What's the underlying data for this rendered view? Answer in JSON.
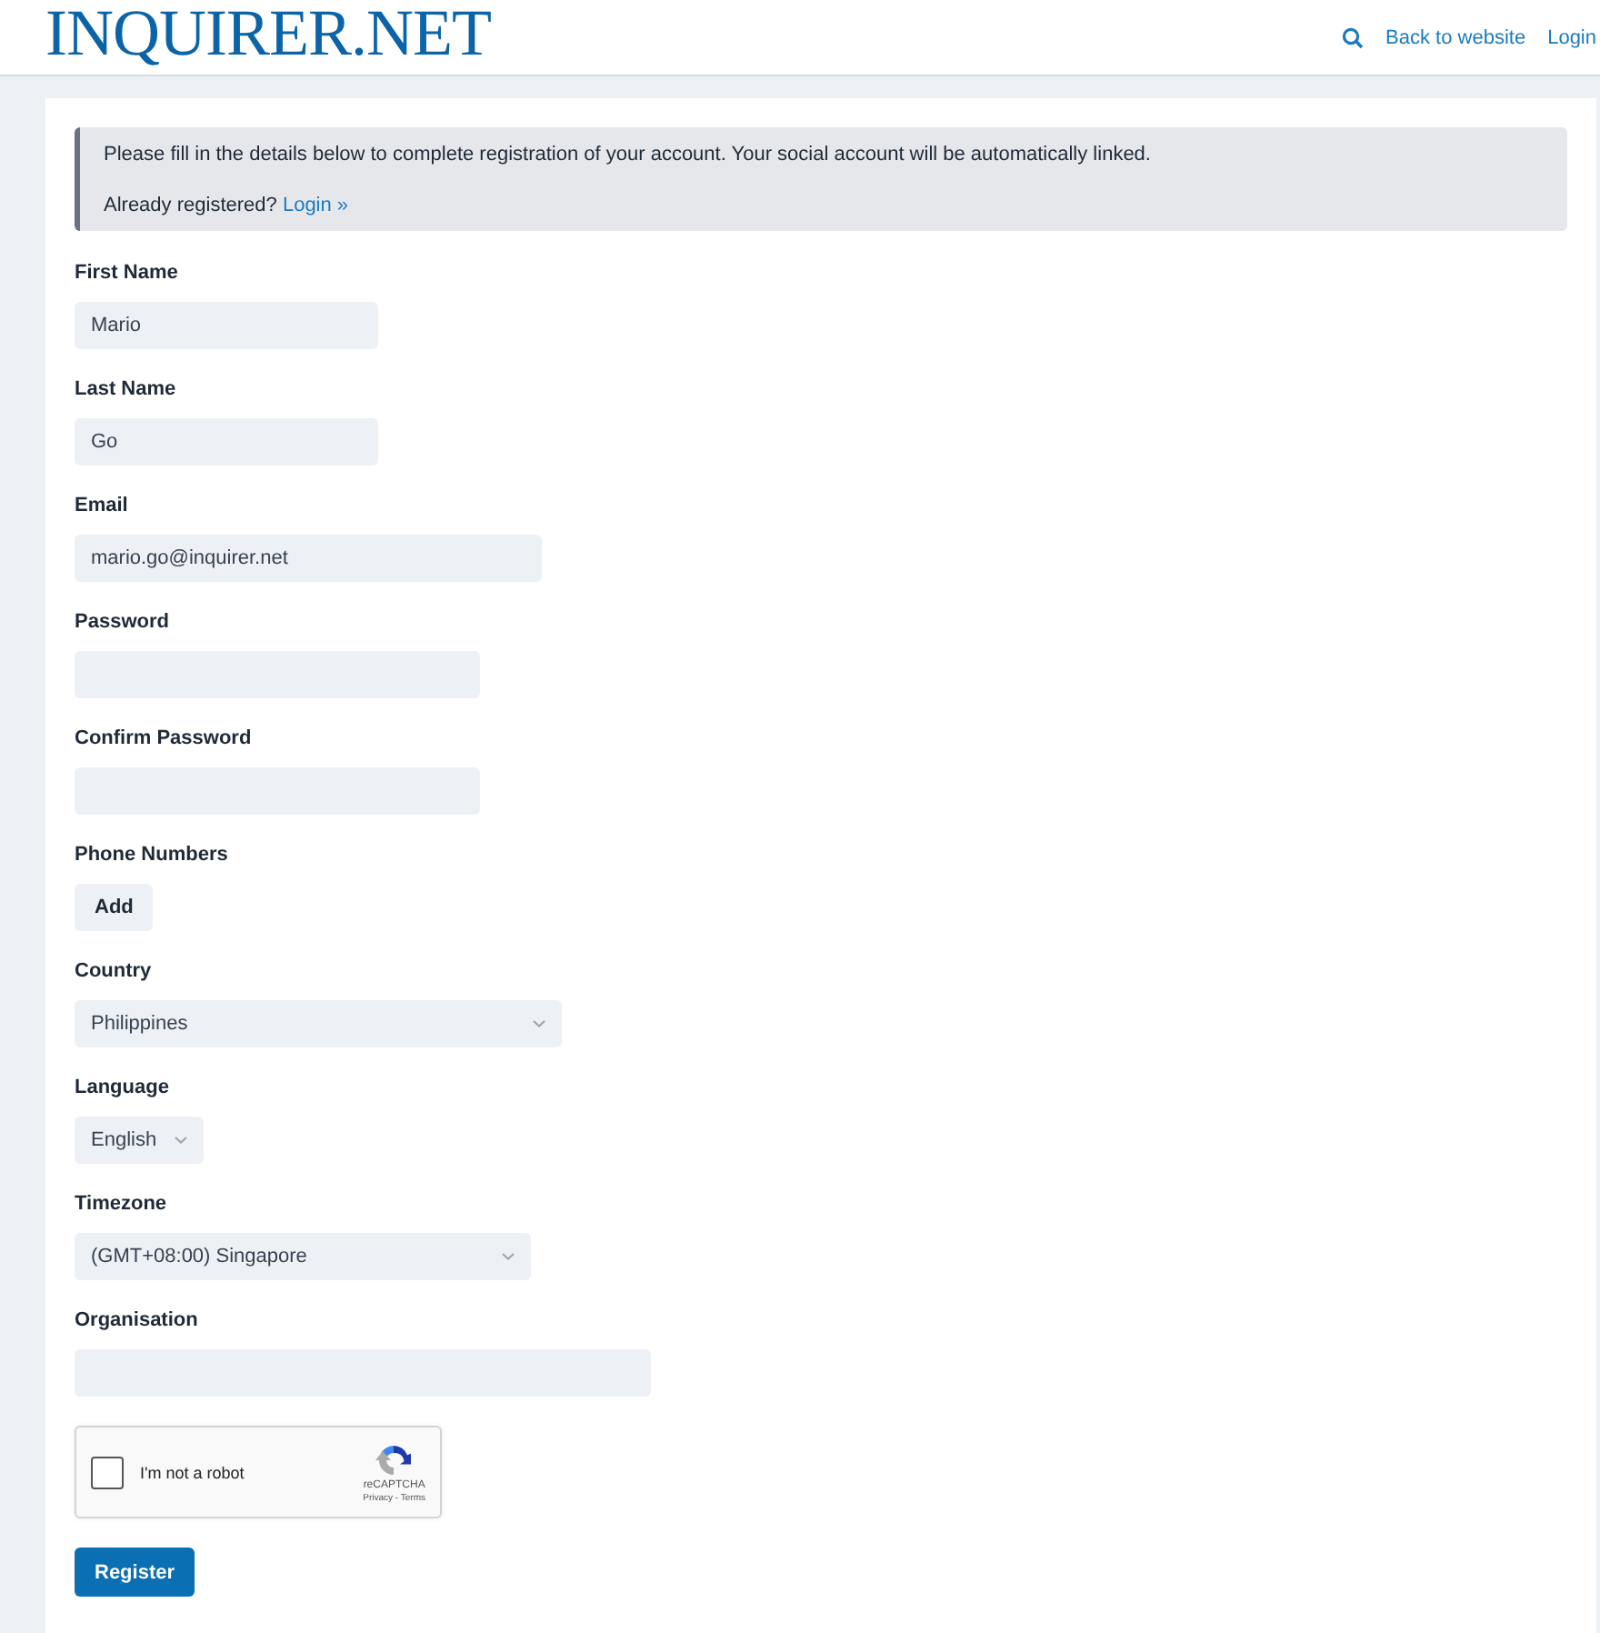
{
  "header": {
    "logo": "INQUIRER.NET",
    "links": [
      "Back to website",
      "Login"
    ]
  },
  "notice": {
    "message": "Please fill in the details below to complete registration of your account. Your social account will be automatically linked.",
    "prompt": "Already registered?",
    "link": "Login »"
  },
  "fields": [
    {
      "kind": "text",
      "label": "First Name",
      "value": "Mario"
    },
    {
      "kind": "text",
      "label": "Last Name",
      "value": "Go"
    },
    {
      "kind": "text",
      "label": "Email",
      "value": "mario.go@inquirer.net"
    },
    {
      "kind": "text",
      "label": "Password"
    },
    {
      "kind": "text",
      "label": "Confirm Password"
    },
    {
      "kind": "button",
      "label": "Phone Numbers",
      "value": "Add"
    },
    {
      "kind": "select",
      "label": "Country",
      "value": "Philippines"
    },
    {
      "kind": "select",
      "label": "Language",
      "value": "English"
    },
    {
      "kind": "select",
      "label": "Timezone",
      "value": "(GMT+08:00) Singapore"
    },
    {
      "kind": "text",
      "label": "Organisation"
    }
  ],
  "captcha": {
    "label": "I'm not a robot",
    "checked": false,
    "brand": "reCAPTCHA",
    "links": "Privacy - Terms"
  },
  "submit": "Register"
}
